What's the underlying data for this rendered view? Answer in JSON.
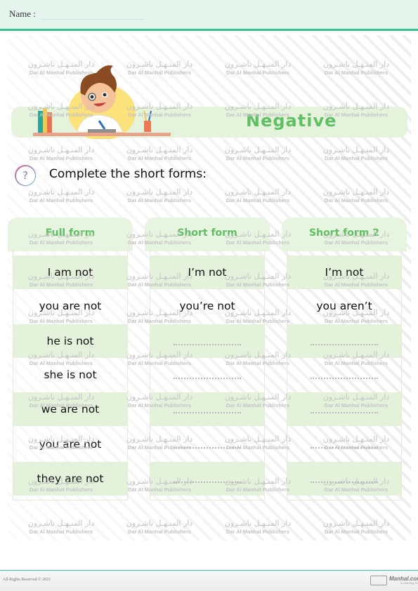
{
  "header": {
    "name_label": "Name :"
  },
  "banner": {
    "title": "Negative"
  },
  "question": {
    "icon": "question-icon",
    "instruction": "Complete the short forms:"
  },
  "columns": [
    {
      "title": "Full form",
      "rows": [
        "I am not",
        "you are not",
        "he is not",
        "she is not",
        "we are not",
        "you are not",
        "they are not"
      ]
    },
    {
      "title": "Short form",
      "rows": [
        "I’m not",
        "you’re not",
        "",
        "",
        "",
        "",
        ""
      ]
    },
    {
      "title": "Short form 2",
      "rows": [
        "I’m not",
        "you aren’t",
        "",
        "",
        "",
        "",
        ""
      ]
    }
  ],
  "watermark": {
    "arabic": "دار المنـهـل ناشـرون",
    "english": "Dar Al Manhal Publishers"
  },
  "footer": {
    "copyright": "All Rights Reserved © 2021",
    "logo_text": "Manhal.com",
    "logo_sub": "A Learning Team"
  },
  "colors": {
    "accent": "#3dbf8e",
    "title_green": "#5fbf62",
    "panel_green": "#e5f3dd",
    "header_bg": "#e6f4ee"
  }
}
